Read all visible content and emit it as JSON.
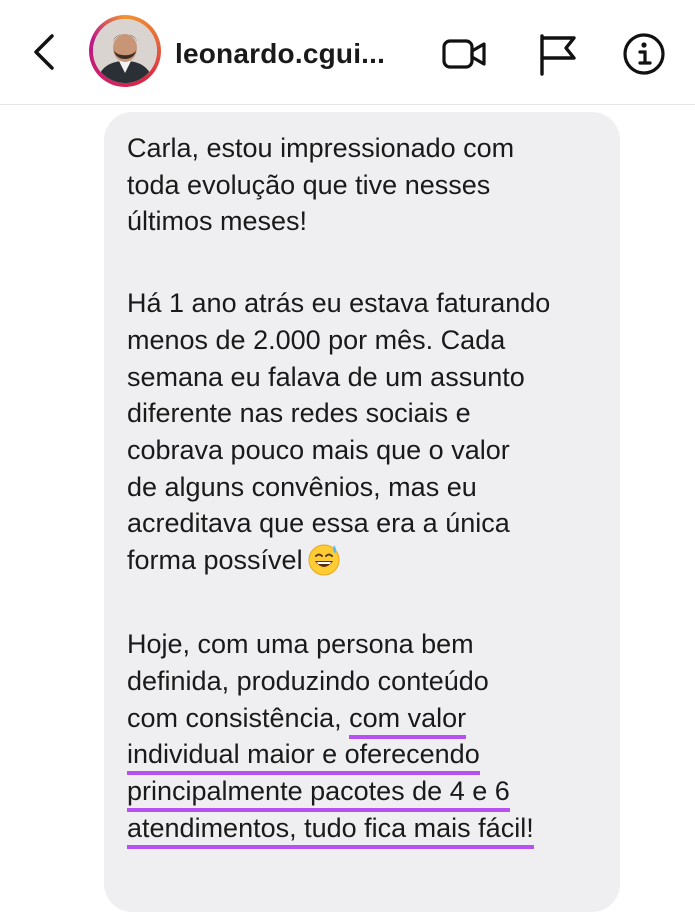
{
  "header": {
    "username": "leonardo.cgui...",
    "icons": {
      "back": "chevron-left-icon",
      "video": "video-call-icon",
      "flag": "flag-icon",
      "info": "info-icon"
    }
  },
  "message": {
    "p1": {
      "l1": "Carla, estou impressionado com",
      "l2": "toda evolução que tive nesses",
      "l3": "últimos meses!"
    },
    "p2": {
      "l1": "Há 1 ano atrás eu estava faturando",
      "l2": "menos de 2.000 por mês. Cada",
      "l3": "semana eu falava de um assunto",
      "l4": "diferente nas redes sociais e",
      "l5": "cobrava pouco mais que o valor",
      "l6": "de alguns convênios, mas eu",
      "l7": "acreditava que essa era a única",
      "l8": "forma possível"
    },
    "p3": {
      "l1": "Hoje, com uma persona bem",
      "l2": "definida, produzindo conteúdo",
      "l3_pre": "com consistência,",
      "l3_hl": "com valor",
      "l4": "individual maior e oferecendo",
      "l5": "principalmente pacotes de 4 e 6",
      "l6": "atendimentos, tudo fica mais fácil!"
    },
    "emoji": "grinning-sweat-emoji",
    "highlight_color": "#b84ff0"
  }
}
